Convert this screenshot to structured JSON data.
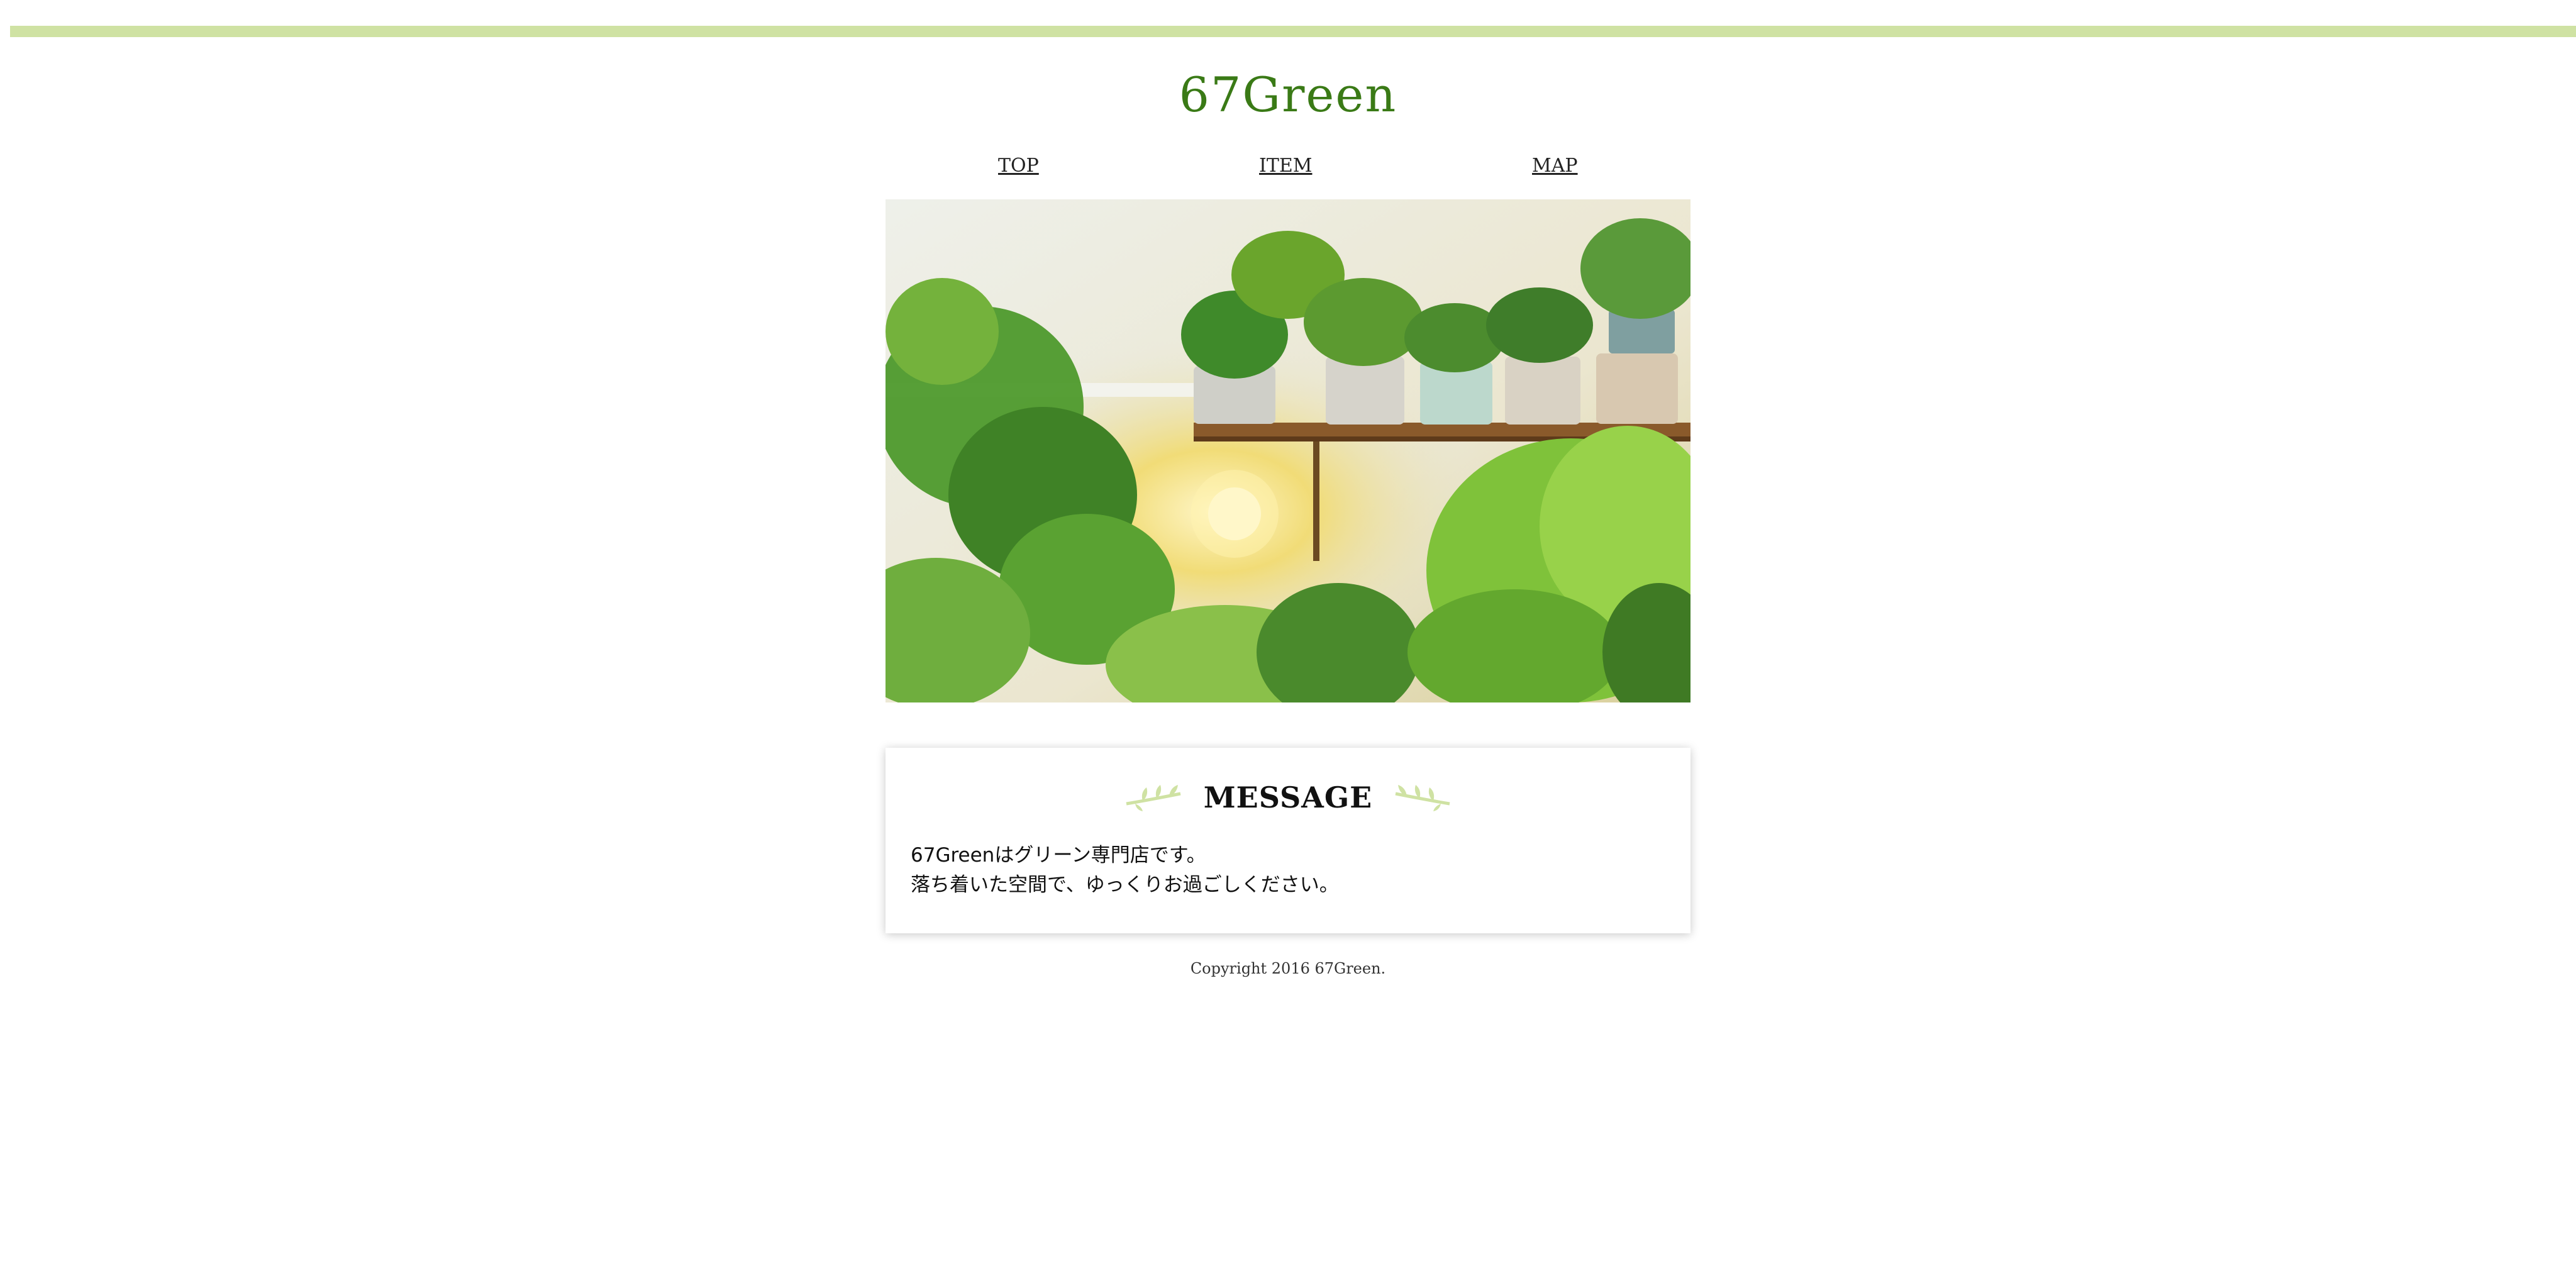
{
  "header": {
    "logo": "67Green"
  },
  "nav": {
    "items": [
      {
        "label": "TOP"
      },
      {
        "label": "ITEM"
      },
      {
        "label": "MAP"
      }
    ]
  },
  "hero": {
    "image": "plants-on-shelf-photo"
  },
  "message": {
    "title": "MESSAGE",
    "lines": [
      "67Greenはグリーン専門店です。",
      "落ち着いた空間で、ゆっくりお過ごしください。"
    ]
  },
  "footer": {
    "copyright": "Copyright 2016 67Green."
  },
  "colors": {
    "top_bar": "#cfe2a3",
    "logo": "#3a7a16",
    "leaf_deco": "#cfe2a3"
  }
}
